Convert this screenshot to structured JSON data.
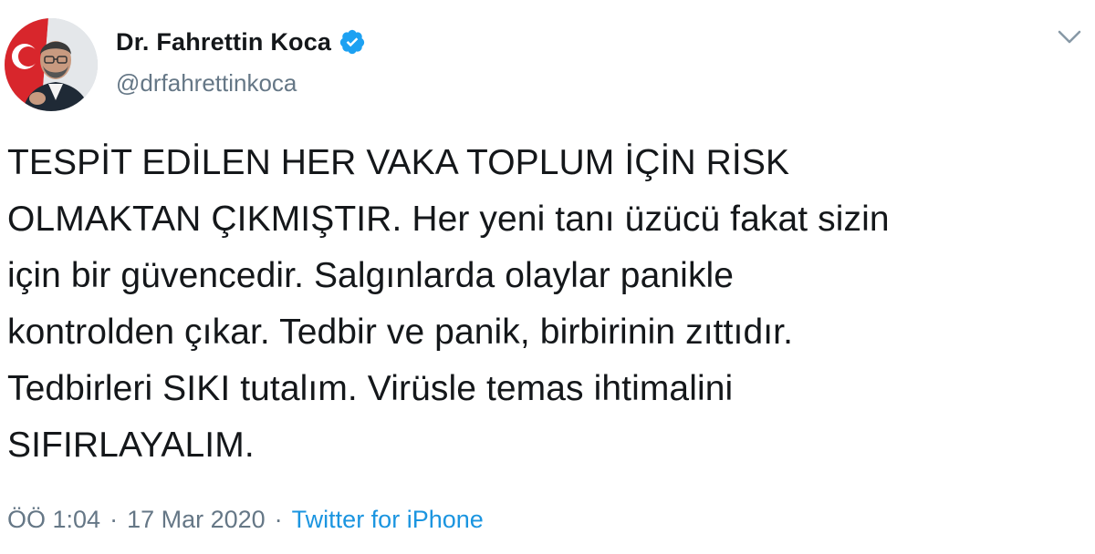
{
  "author": {
    "display_name": "Dr. Fahrettin Koca",
    "handle": "@drfahrettinkoca",
    "verified": true,
    "avatar_icon": "profile-photo"
  },
  "tweet": {
    "text": "TESPİT EDİLEN HER VAKA TOPLUM İÇİN RİSK\nOLMAKTAN ÇIKMIŞTIR. Her yeni tanı üzücü fakat sizin\niçin bir güvencedir. Salgınlarda olaylar panikle\nkontrolden çıkar. Tedbir ve panik, birbirinin zıttıdır.\nTedbirleri SIKI tutalım. Virüsle temas ihtimalini\nSIFIRLAYALIM."
  },
  "meta": {
    "time": "ÖÖ 1:04",
    "separator": "·",
    "date": "17 Mar 2020",
    "source": "Twitter for iPhone"
  },
  "icons": {
    "verified": "verified-badge-icon",
    "menu": "chevron-down-icon"
  },
  "colors": {
    "verified_blue": "#1da1f2",
    "link_blue": "#1b95e0",
    "secondary_text": "#657786",
    "primary_text": "#14171a"
  }
}
